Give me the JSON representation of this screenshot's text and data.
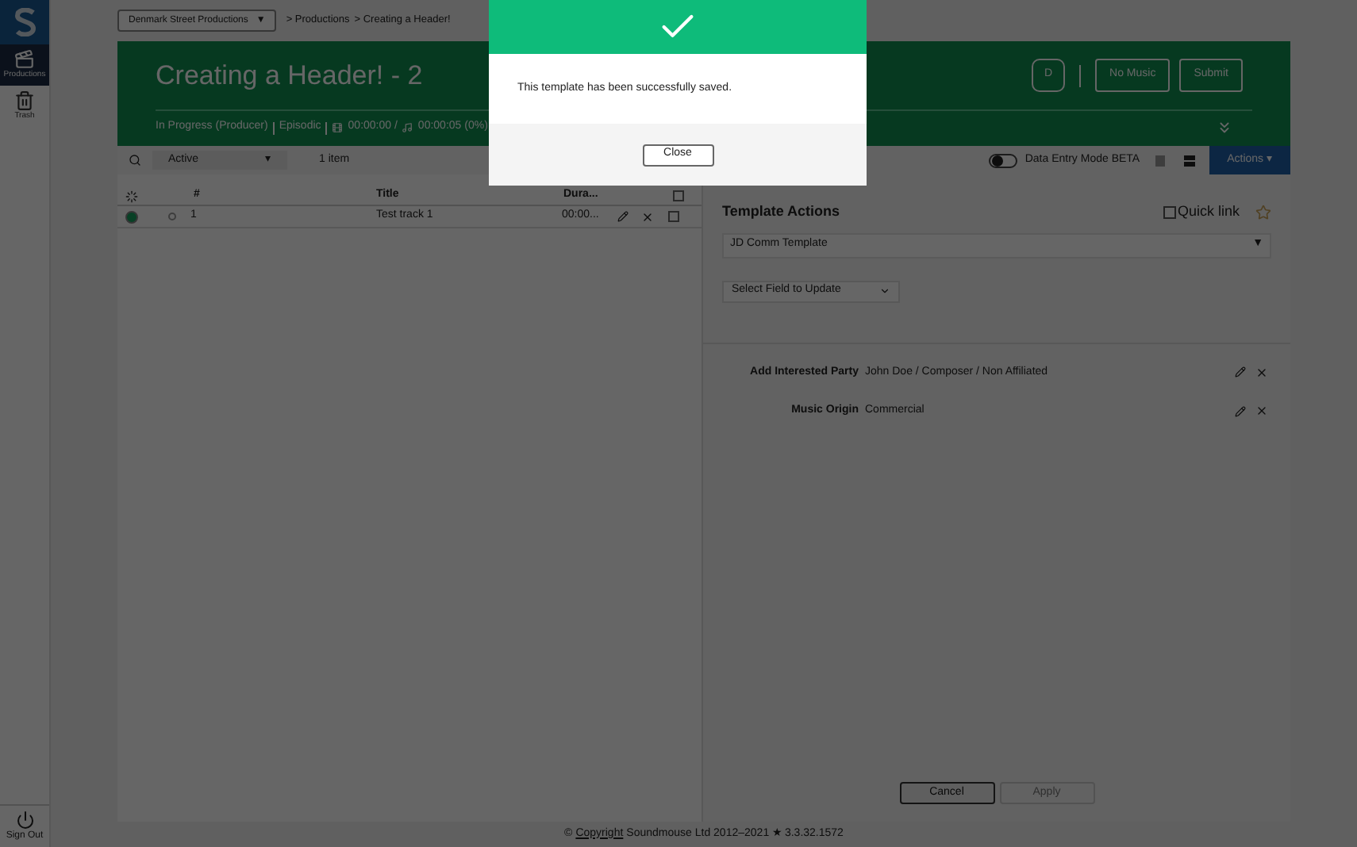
{
  "sidebar": {
    "items": [
      {
        "label": "Productions",
        "kind": "productions",
        "selected": true
      },
      {
        "label": "Trash",
        "kind": "trash",
        "selected": false
      }
    ],
    "sign_out": "Sign Out"
  },
  "breadcrumb": {
    "company": "Denmark Street Productions",
    "caret": "▼",
    "path": [
      "> Productions",
      "> Creating a Header!"
    ]
  },
  "header": {
    "title": "Creating a Header! - 2",
    "status": "In Progress (Producer)",
    "type": "Episodic",
    "durations": "00:00:00 / ",
    "total": "00:00:05 (0%)",
    "badge": "D",
    "buttons": [
      "No Music",
      "Submit"
    ]
  },
  "toolbar": {
    "filter": "Active",
    "filter_caret": "▾",
    "count": "1 item",
    "data_entry_mode": {
      "label": "Data Entry Mode BETA",
      "on": false
    },
    "actions": "Actions ▾"
  },
  "table": {
    "columns": [
      "#",
      "Title",
      "Dura..."
    ],
    "all_checked": false,
    "rows": [
      {
        "selected": true,
        "checked": false,
        "number": "1",
        "title": "Test track 1",
        "duration": "00:00..."
      }
    ]
  },
  "template": {
    "title": "Template Actions",
    "quick_link": {
      "label": "Quick link",
      "checked": false
    },
    "template_select": "JD Comm Template",
    "template_caret": "▼",
    "field_select": "Select Field to Update",
    "fields": [
      {
        "label": "Add Interested Party",
        "value": "John Doe / Composer / Non Affiliated"
      },
      {
        "label": "Music Origin",
        "value": "Commercial"
      }
    ],
    "buttons": [
      {
        "label": "Cancel",
        "disabled": false
      },
      {
        "label": "Apply",
        "disabled": true
      }
    ]
  },
  "footer": {
    "prefix": "©",
    "link": "Copyright",
    "text": "Soundmouse Ltd 2012–2021 ★ 3.3.32.1572"
  },
  "dialog": {
    "message": "This template has been successfully saved.",
    "button": "Close"
  }
}
